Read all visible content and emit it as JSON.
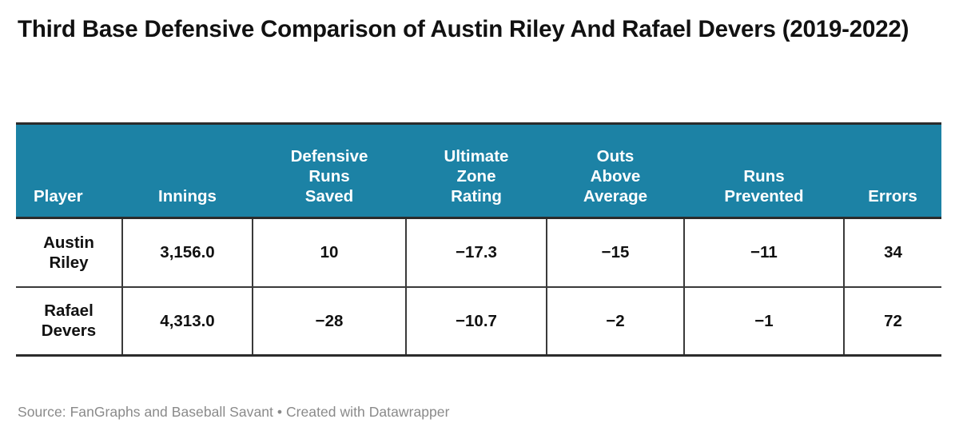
{
  "title": "Third Base Defensive Comparison of Austin Riley And Rafael Devers (2019-2022)",
  "footer": "Source: FanGraphs and Baseball Savant • Created with Datawrapper",
  "colors": {
    "header_background": "#1c82a5",
    "header_text": "#ffffff",
    "body_text": "#111111",
    "rule": "#2b2b2b",
    "cell_divider": "#3a3a3a",
    "footer_text": "#8a8a8a",
    "page_background": "#ffffff"
  },
  "chart_data": {
    "type": "table",
    "title": "Third Base Defensive Comparison of Austin Riley And Rafael Devers (2019-2022)",
    "source": "Source: FanGraphs and Baseball Savant • Created with Datawrapper",
    "columns": [
      "Player",
      "Innings",
      "Defensive Runs Saved",
      "Ultimate Zone Rating",
      "Outs Above Average",
      "Runs Prevented",
      "Errors"
    ],
    "rows": [
      [
        "Austin Riley",
        "3,156.0",
        "10",
        "−17.3",
        "−15",
        "−11",
        "34"
      ],
      [
        "Rafael Devers",
        "4,313.0",
        "−28",
        "−10.7",
        "−2",
        "−1",
        "72"
      ]
    ]
  },
  "table": {
    "headers": {
      "player": "Player",
      "innings": "Innings",
      "drs_line1": "Defensive",
      "drs_line2": "Runs",
      "drs_line3": "Saved",
      "uzr_line1": "Ultimate",
      "uzr_line2": "Zone",
      "uzr_line3": "Rating",
      "oaa_line1": "Outs",
      "oaa_line2": "Above",
      "oaa_line3": "Average",
      "rp_line1": "Runs",
      "rp_line2": "Prevented",
      "errors": "Errors"
    },
    "rows": [
      {
        "player_line1": "Austin",
        "player_line2": "Riley",
        "innings": "3,156.0",
        "drs": "10",
        "uzr": "−17.3",
        "oaa": "−15",
        "rp": "−11",
        "errors": "34"
      },
      {
        "player_line1": "Rafael",
        "player_line2": "Devers",
        "innings": "4,313.0",
        "drs": "−28",
        "uzr": "−10.7",
        "oaa": "−2",
        "rp": "−1",
        "errors": "72"
      }
    ]
  }
}
